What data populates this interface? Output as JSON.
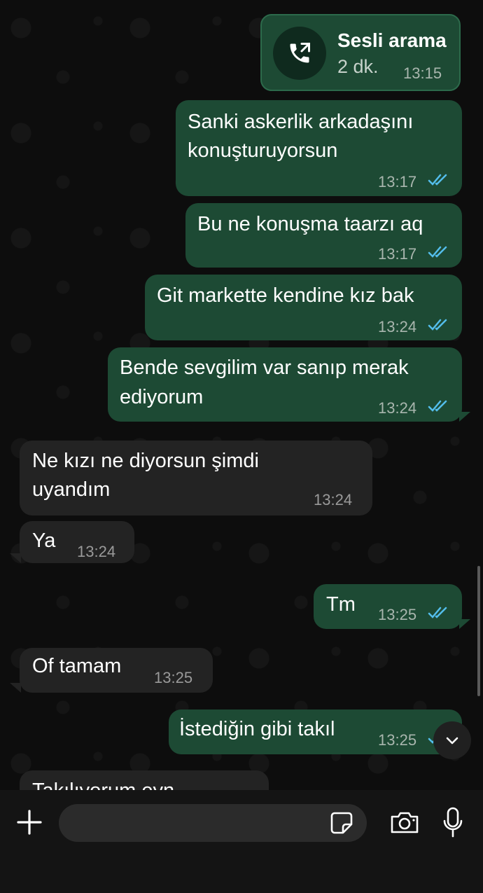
{
  "call": {
    "title": "Sesli arama",
    "duration": "2 dk.",
    "time": "13:15",
    "icon": "phone-outgoing-icon"
  },
  "messages": [
    {
      "dir": "out",
      "text_lines": [
        "Sanki  askerlik arkadaşını",
        "konuşturuyorsun"
      ],
      "time": "13:17",
      "read": true
    },
    {
      "dir": "out",
      "text_lines": [
        "Bu ne konuşma taarzı aq"
      ],
      "time": "13:17",
      "read": true
    },
    {
      "dir": "out",
      "text_lines": [
        "Git markette kendine kız bak"
      ],
      "time": "13:24",
      "read": true
    },
    {
      "dir": "out",
      "text_lines": [
        "Bende sevgilim var sanıp merak",
        "ediyorum"
      ],
      "time": "13:24",
      "read": true
    },
    {
      "dir": "in",
      "text_lines": [
        "Ne kızı ne diyorsun şimdi",
        "uyandım"
      ],
      "time": "13:24"
    },
    {
      "dir": "in",
      "text_lines": [
        "Ya"
      ],
      "time": "13:24"
    },
    {
      "dir": "out",
      "text_lines": [
        "Tm"
      ],
      "time": "13:25",
      "read": true
    },
    {
      "dir": "in",
      "text_lines": [
        "Of tamam"
      ],
      "time": "13:25"
    },
    {
      "dir": "out",
      "text_lines": [
        "İstediğin gibi takıl"
      ],
      "time": "13:25",
      "read": true
    },
    {
      "dir": "in",
      "text_lines": [
        "Takılıyorum eyn"
      ],
      "time": ""
    }
  ],
  "colors": {
    "outgoing_bubble": "#1d4a34",
    "incoming_bubble": "#232323",
    "read_ticks": "#53bdeb",
    "background": "#0d0d0d"
  },
  "composer": {
    "placeholder": "",
    "icons": [
      "plus-icon",
      "sticker-icon",
      "camera-icon",
      "microphone-icon"
    ]
  },
  "scroll_button": {
    "icon": "chevron-down-icon"
  }
}
